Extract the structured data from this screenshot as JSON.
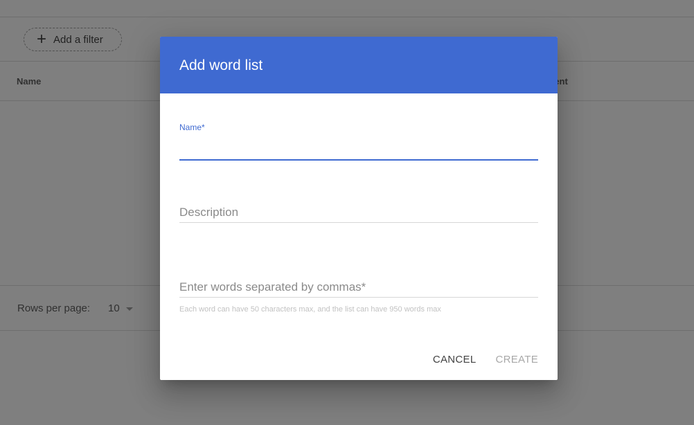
{
  "background": {
    "filter_chip": {
      "label": "Add a filter",
      "icon": "plus-icon"
    },
    "table": {
      "columns": [
        "Name",
        "ntent"
      ]
    },
    "footer": {
      "rows_per_page_label": "Rows per page:",
      "rows_per_page_value": "10"
    }
  },
  "dialog": {
    "title": "Add word list",
    "name_field": {
      "label": "Name*",
      "value": ""
    },
    "description_field": {
      "placeholder": "Description",
      "value": ""
    },
    "words_field": {
      "placeholder": "Enter words separated by commas*",
      "value": ""
    },
    "helper_text": "Each word can have 50 characters max, and the list can have 950 words max",
    "buttons": {
      "cancel": "CANCEL",
      "create": "CREATE"
    }
  },
  "colors": {
    "accent": "#3f6ad1",
    "scrim": "rgba(0,0,0,0.5)"
  }
}
